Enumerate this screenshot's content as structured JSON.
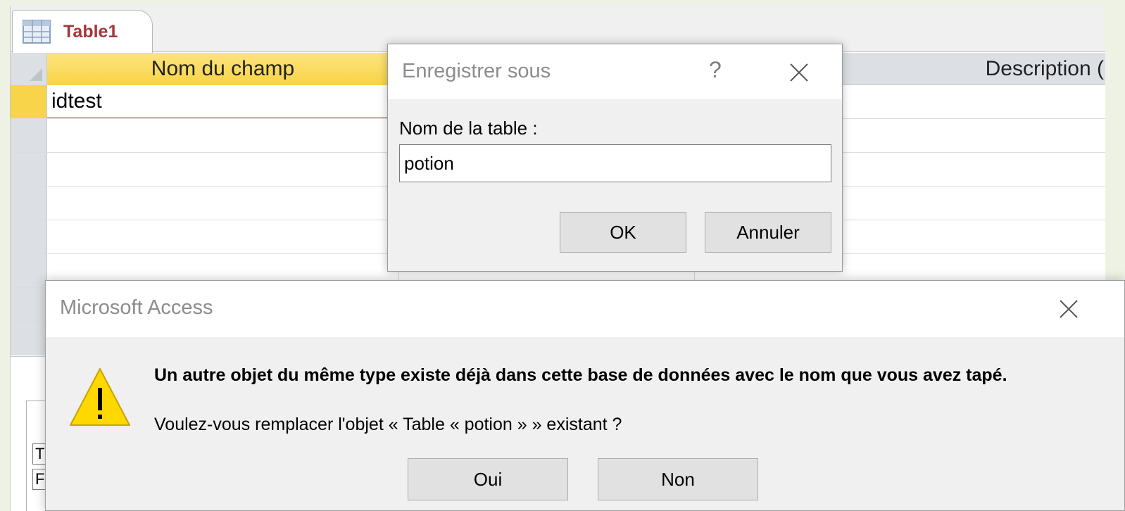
{
  "document_tab": {
    "label": "Table1",
    "icon": "table-icon"
  },
  "grid": {
    "columns": [
      "Nom du champ",
      "",
      "Description ("
    ],
    "rows": [
      "idtest",
      "",
      "",
      "",
      "",
      "",
      "",
      ""
    ]
  },
  "properties_panel": {
    "cells": [
      "T",
      "F"
    ]
  },
  "save_dialog": {
    "title": "Enregistrer sous",
    "help": "?",
    "field_label": "Nom de la table :",
    "field_value": "potion",
    "ok_label": "OK",
    "cancel_label": "Annuler"
  },
  "access_dialog": {
    "title": "Microsoft Access",
    "icon": "warning-icon",
    "message": "Un autre objet du même type existe déjà dans cette base de données avec le nom que vous avez tapé.",
    "question": "Voulez-vous remplacer l'objet « Table « potion » » existant ?",
    "yes_label": "Oui",
    "no_label": "Non"
  },
  "colors": {
    "tab_text": "#a4373a",
    "active_header": "#f9d445",
    "warning": "#ffd700"
  }
}
